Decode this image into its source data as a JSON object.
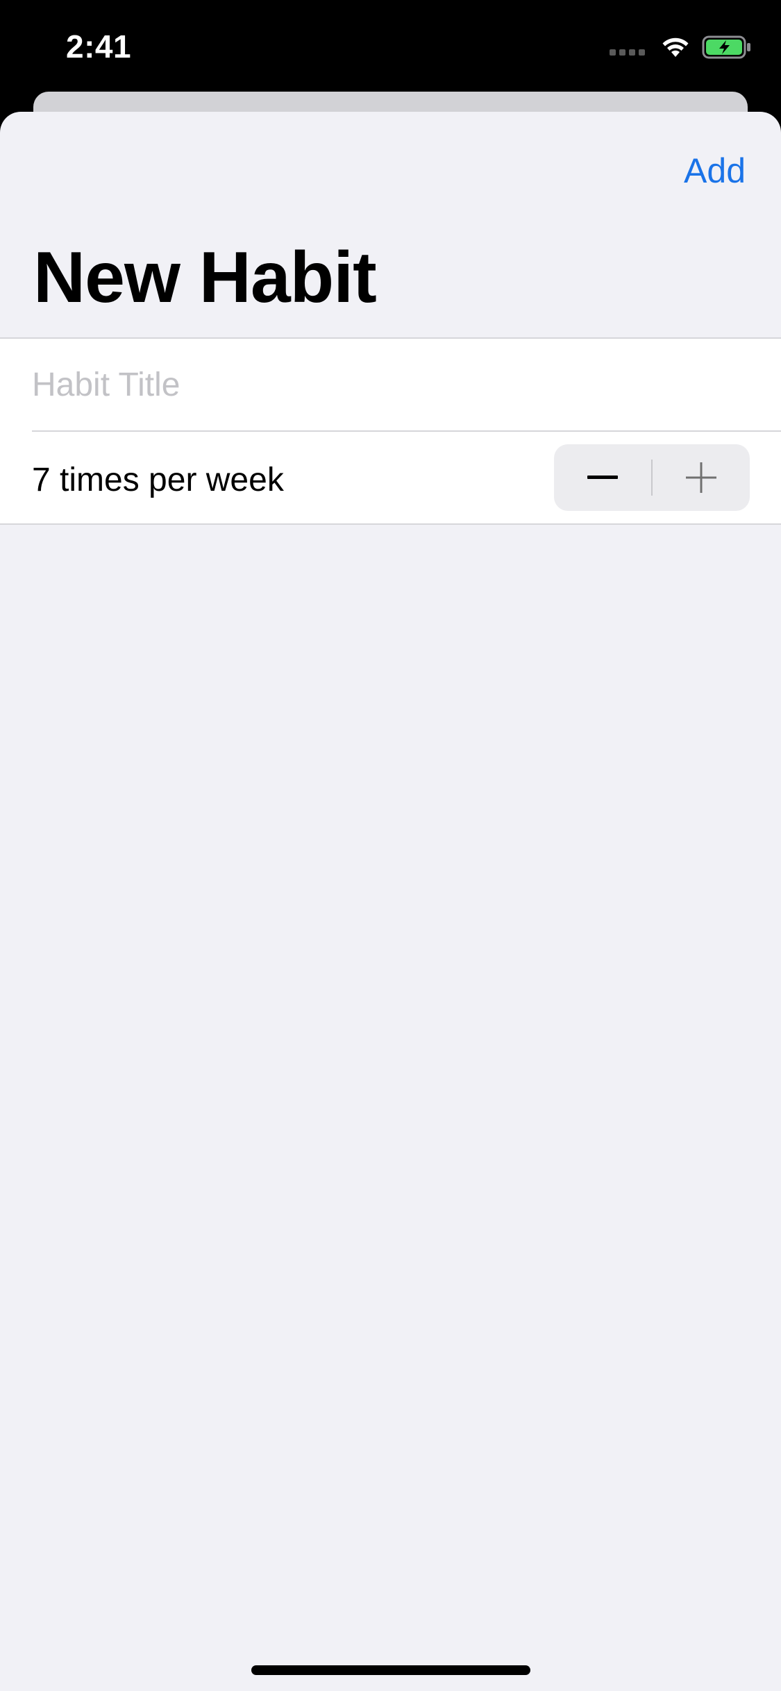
{
  "status_bar": {
    "time": "2:41",
    "icons": [
      "cellular-signal-icon",
      "wifi-icon",
      "battery-charging-icon"
    ],
    "battery_color": "#4cd964"
  },
  "nav": {
    "add_label": "Add"
  },
  "page": {
    "title": "New Habit"
  },
  "form": {
    "title_field": {
      "value": "",
      "placeholder": "Habit Title"
    },
    "frequency": {
      "label": "7 times per week",
      "stepper": {
        "decrement_icon": "minus-icon",
        "increment_icon": "plus-icon"
      }
    }
  },
  "colors": {
    "accent": "#1a73e8",
    "sheet_background": "#f1f1f6",
    "status_background": "#000000"
  }
}
